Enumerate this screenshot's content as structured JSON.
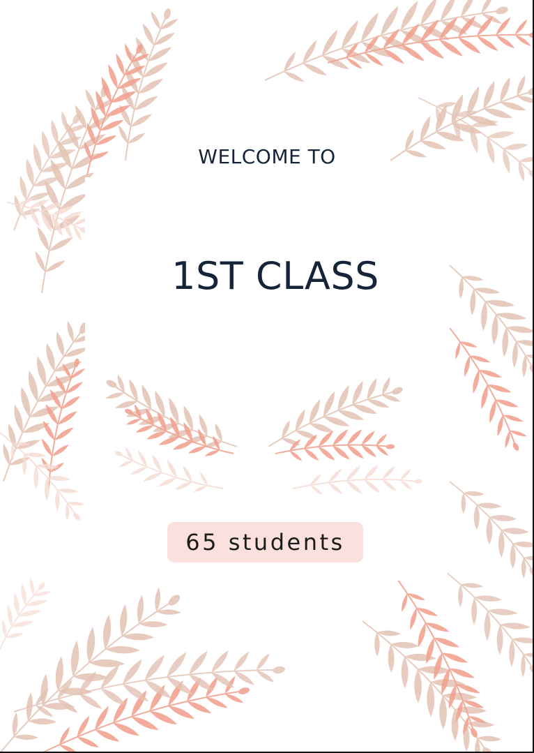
{
  "poster": {
    "heading": "WELCOME TO",
    "title": "1ST CLASS",
    "students_badge": "65 students"
  },
  "colors": {
    "text": "#16243a",
    "badge_bg": "#fbe1dd",
    "leaf_beige": "#e3c3b3",
    "leaf_coral": "#f2a391",
    "leaf_pale": "#f6dcd3"
  },
  "decor": {
    "icon": "fern-leaf-icon"
  }
}
